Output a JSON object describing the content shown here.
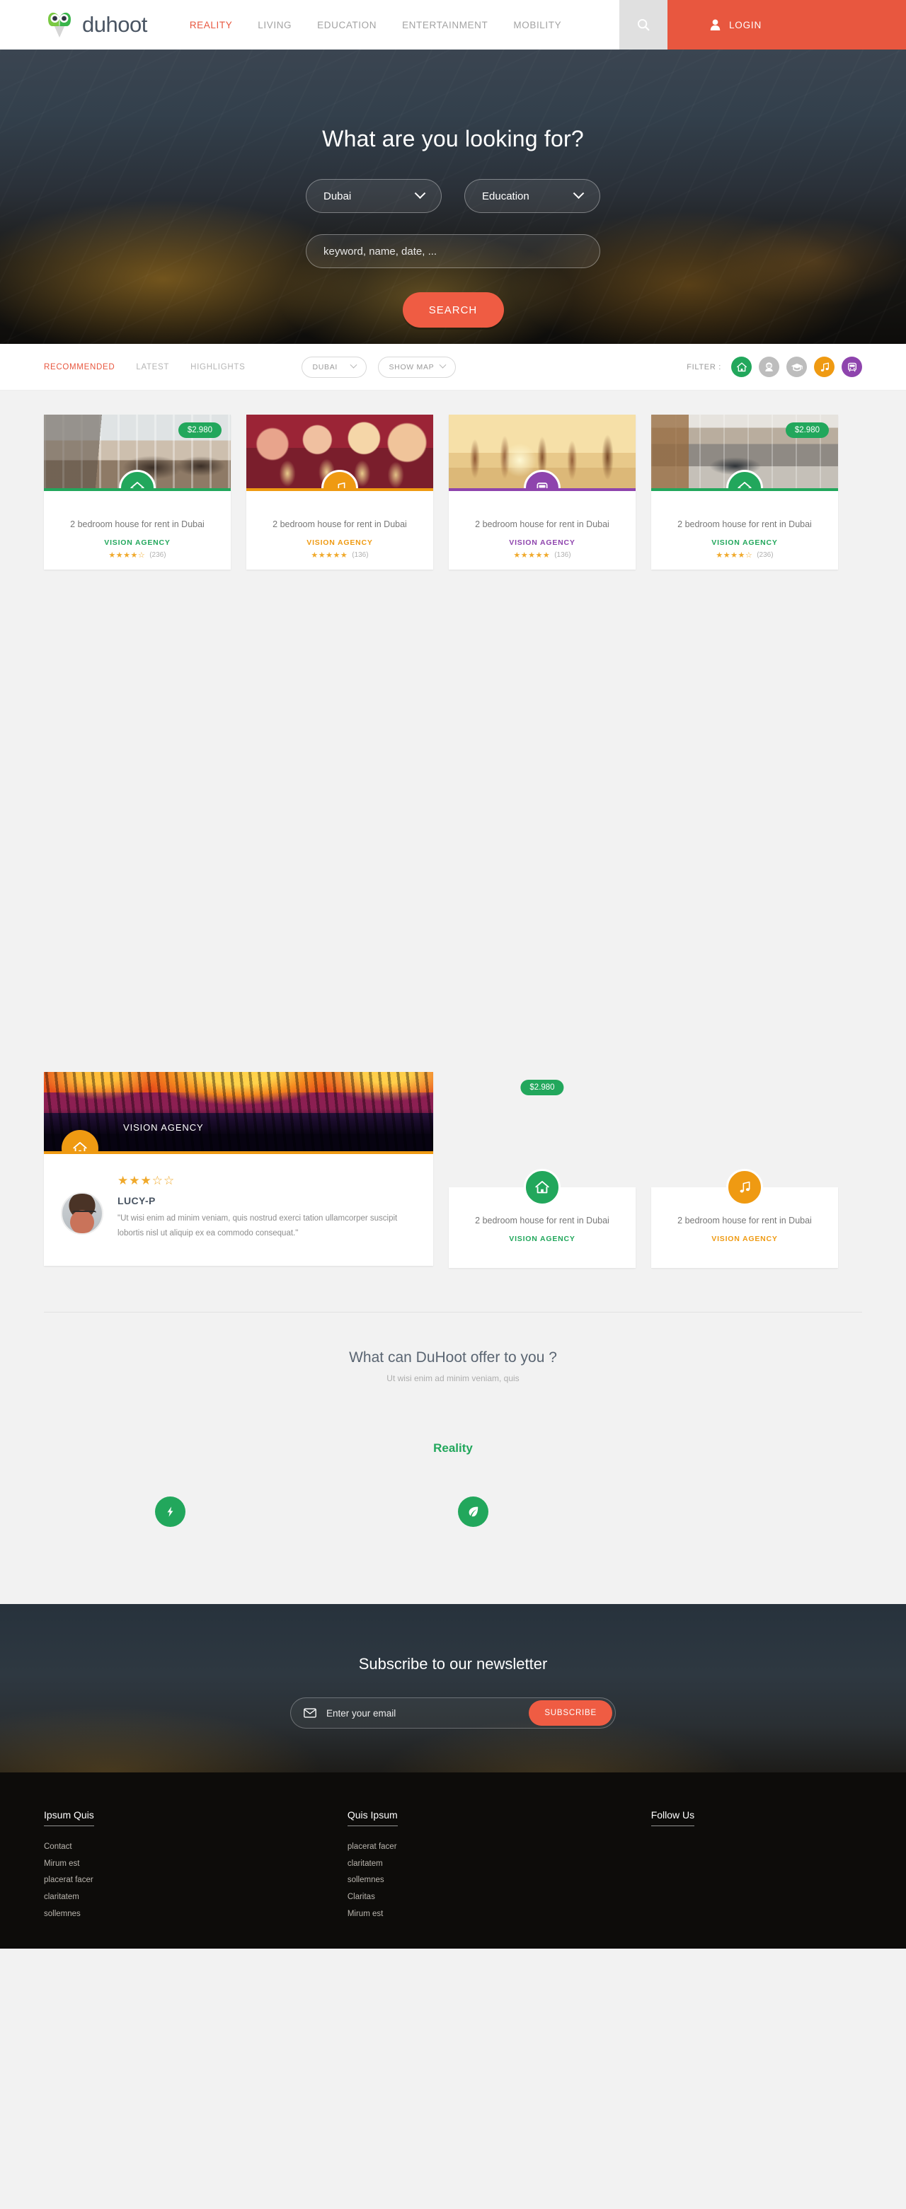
{
  "header": {
    "logo_text": "duhoot",
    "logo_icon": "owl-logo",
    "nav": [
      {
        "label": "REALITY",
        "active": true
      },
      {
        "label": "LIVING",
        "active": false
      },
      {
        "label": "EDUCATION",
        "active": false
      },
      {
        "label": "ENTERTAINMENT",
        "active": false
      },
      {
        "label": "MOBILITY",
        "active": false
      }
    ],
    "search_icon": "search-icon",
    "login_label": "LOGIN",
    "login_icon": "user-icon",
    "accent_color": "#e8573f"
  },
  "hero": {
    "title": "What are you looking for?",
    "city_select": "Dubai",
    "category_select": "Education",
    "keyword_placeholder": "keyword, name, date, ...",
    "search_button": "SEARCH"
  },
  "filterbar": {
    "sorts": [
      {
        "label": "RECOMMENDED",
        "active": true
      },
      {
        "label": "LATEST",
        "active": false
      },
      {
        "label": "HIGHLIGHTS",
        "active": false
      }
    ],
    "city_pill": "DUBAI",
    "map_pill": "SHOW MAP",
    "filter_label": "FILTER :",
    "filters": [
      {
        "icon": "home-icon",
        "color": "#22a75c",
        "active": true
      },
      {
        "icon": "person-icon",
        "color": "#bdbdbd",
        "active": false
      },
      {
        "icon": "graduation-cap-icon",
        "color": "#bdbdbd",
        "active": false
      },
      {
        "icon": "music-note-icon",
        "color": "#ef9a12",
        "active": true
      },
      {
        "icon": "bus-icon",
        "color": "#8e44ad",
        "active": true
      }
    ]
  },
  "cards": [
    {
      "price": "$2.980",
      "photo": "ph-terrace",
      "icon": "home-icon",
      "color": "#22a75c",
      "title": "2 bedroom house for rent in Dubai",
      "agency": "VISION AGENCY",
      "stars": "★★★★☆",
      "count": "(236)"
    },
    {
      "price": "",
      "photo": "ph-girls",
      "icon": "music-note-icon",
      "color": "#ef9a12",
      "title": "2 bedroom house for rent in Dubai",
      "agency": "VISION AGENCY",
      "stars": "★★★★★",
      "count": "(136)"
    },
    {
      "price": "",
      "photo": "ph-beach",
      "icon": "bus-icon",
      "color": "#8e44ad",
      "title": "2 bedroom house for rent in Dubai",
      "agency": "VISION AGENCY",
      "stars": "★★★★★",
      "count": "(136)"
    },
    {
      "price": "$2.980",
      "photo": "ph-living",
      "icon": "home-icon",
      "color": "#22a75c",
      "title": "2 bedroom house for rent in Dubai",
      "agency": "VISION AGENCY",
      "stars": "★★★★☆",
      "count": "(236)"
    }
  ],
  "featured": {
    "testimonial": {
      "agency": "VISION AGENCY",
      "icon": "home-icon",
      "color": "#ef9a12",
      "stars": "★★★☆☆",
      "name": "LUCY-P",
      "quote": "\"Ut wisi enim ad minim veniam, quis nostrud exerci tation ullamcorper suscipit lobortis nisl ut aliquip ex ea commodo consequat.\"",
      "avatar": "user-avatar"
    },
    "mini_cards": [
      {
        "price": "$2.980",
        "icon": "home-icon",
        "color": "#22a75c",
        "title": "2 bedroom house for rent in Dubai",
        "agency": "VISION AGENCY"
      },
      {
        "price": "",
        "icon": "music-note-icon",
        "color": "#ef9a12",
        "title": "2 bedroom house for rent in Dubai",
        "agency": "VISION AGENCY"
      }
    ]
  },
  "offer": {
    "title": "What can DuHoot offer to you ?",
    "subtitle": "Ut wisi enim ad minim veniam, quis",
    "reality_title": "Reality",
    "reality_color": "#22a75c",
    "icons": [
      {
        "icon": "lightning-bolt-icon"
      },
      {
        "icon": "leaf-icon"
      }
    ]
  },
  "newsletter": {
    "title": "Subscribe to our newsletter",
    "email_placeholder": "Enter your email",
    "mail_icon": "mail-icon",
    "subscribe_label": "SUBSCRIBE"
  },
  "footer": {
    "columns": [
      {
        "heading": "Ipsum Quis",
        "links": [
          "Contact",
          "Mirum est",
          "placerat facer",
          "claritatem",
          "sollemnes"
        ]
      },
      {
        "heading": "Quis Ipsum",
        "links": [
          "placerat facer",
          "claritatem",
          "sollemnes",
          "Claritas",
          "Mirum est"
        ]
      },
      {
        "heading": "Follow Us",
        "links": []
      }
    ]
  }
}
